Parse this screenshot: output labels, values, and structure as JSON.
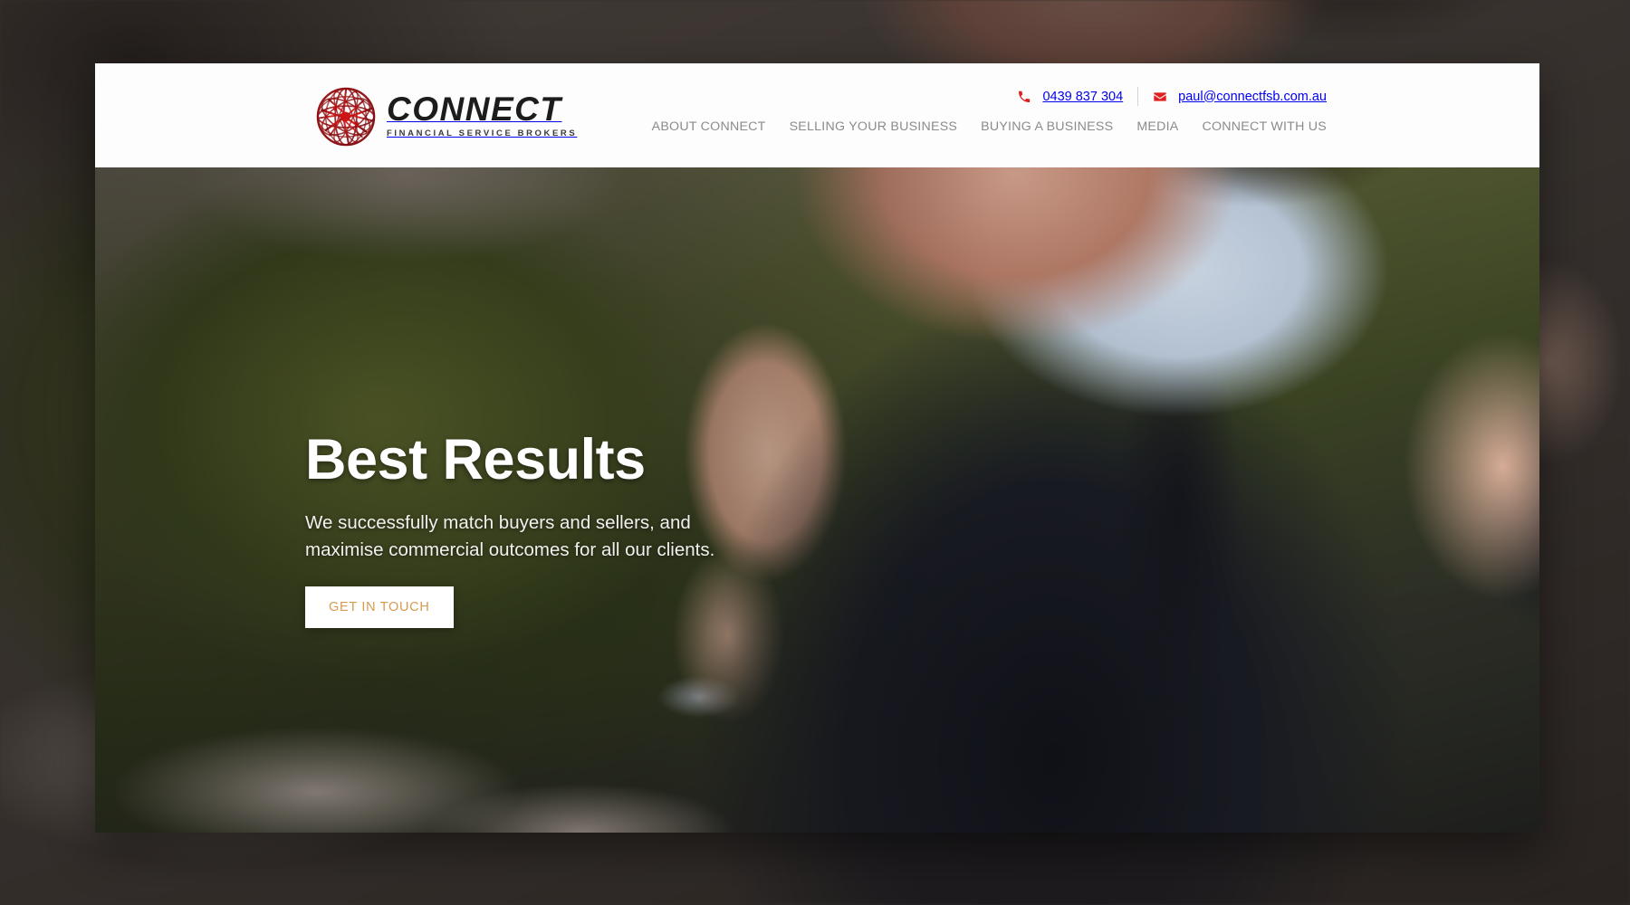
{
  "brand": {
    "name": "CONNECT",
    "tagline": "FINANCIAL SERVICE BROKERS",
    "logo_icon": "globe-network-icon",
    "logo_color": "#c81414",
    "logo_color_dark": "#8c0d10"
  },
  "header": {
    "contact": {
      "phone_icon": "phone-icon",
      "phone": "0439 837 304",
      "email_icon": "envelope-icon",
      "email": "paul@connectfsb.com.au",
      "icon_color": "#e02020",
      "text_color": "#6f6f6f"
    },
    "nav": [
      {
        "label": "ABOUT CONNECT",
        "name": "nav-item-about-connect"
      },
      {
        "label": "SELLING YOUR BUSINESS",
        "name": "nav-item-selling-your-business"
      },
      {
        "label": "BUYING A BUSINESS",
        "name": "nav-item-buying-a-business"
      },
      {
        "label": "MEDIA",
        "name": "nav-item-media"
      },
      {
        "label": "CONNECT WITH US",
        "name": "nav-item-connect-with-us"
      }
    ]
  },
  "hero": {
    "title": "Best Results",
    "subtitle": "We successfully match buyers and sellers, and maximise commercial outcomes for all our clients.",
    "cta_label": "GET IN TOUCH",
    "cta_text_color": "#d79a4f",
    "cta_bg_color": "#ffffff",
    "image_description": "Smiling businessman in a dark navy suit, white shirt and dark tie celebrating with raised fists, blurred green garden background"
  }
}
